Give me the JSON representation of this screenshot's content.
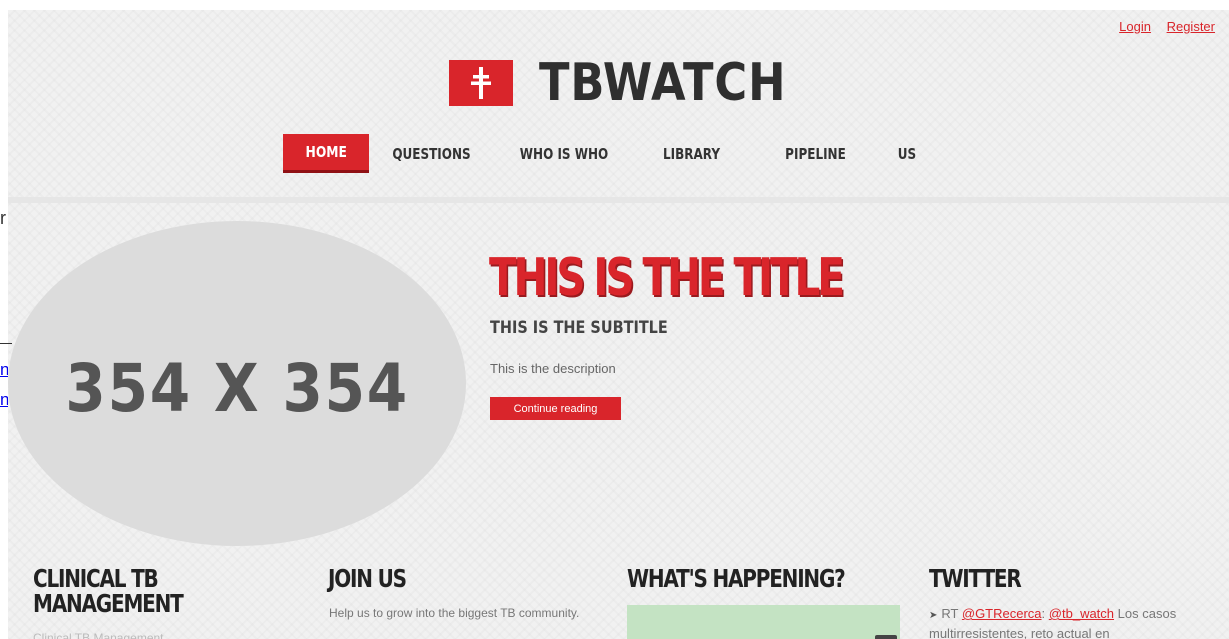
{
  "auth": {
    "login": "Login",
    "register": "Register"
  },
  "brand": {
    "name": "TBWATCH",
    "accent": "#d9252b"
  },
  "nav": {
    "items": [
      "HOME",
      "QUESTIONS",
      "WHO IS WHO",
      "LIBRARY",
      "PIPELINE",
      "US"
    ],
    "active": 0
  },
  "left_fragments": {
    "letter": "r",
    "link_1": "n",
    "link_2": "n"
  },
  "hero": {
    "image_placeholder": "354 X 354",
    "title": "THIS IS THE TITLE",
    "subtitle": "THIS IS THE SUBTITLE",
    "description": "This is the description",
    "button": "Continue reading"
  },
  "columns": {
    "clinical": {
      "title_line1": "CLINICAL TB",
      "title_line2": "MANAGEMENT",
      "text": "Clinical TB Management"
    },
    "join": {
      "title": "JOIN US",
      "text": "Help us to grow into the biggest TB community."
    },
    "happening": {
      "title": "WHAT'S HAPPENING?"
    },
    "twitter": {
      "title": "TWITTER",
      "tweet_prefix": "RT",
      "handle_1": "@GTRecerca",
      "sep": ":",
      "handle_2": "@tb_watch",
      "tweet_text": "Los casos multirresistentes, reto actual en"
    }
  }
}
